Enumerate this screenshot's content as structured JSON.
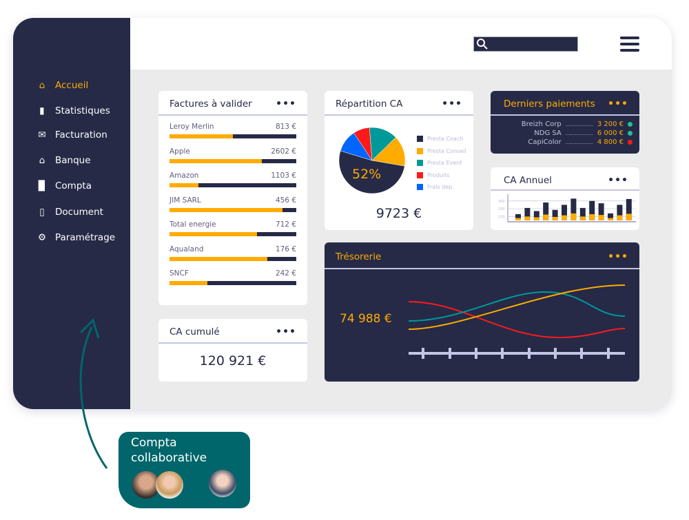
{
  "sidebar": {
    "items": [
      {
        "label": "Accueil",
        "icon": "home-icon",
        "active": true
      },
      {
        "label": "Statistiques",
        "icon": "bar-chart-icon"
      },
      {
        "label": "Facturation",
        "icon": "envelope-icon"
      },
      {
        "label": "Banque",
        "icon": "bank-icon"
      },
      {
        "label": "Compta",
        "icon": "book-icon"
      },
      {
        "label": "Document",
        "icon": "document-icon"
      },
      {
        "label": "Paramétrage",
        "icon": "gear-icon"
      }
    ]
  },
  "header": {
    "search_placeholder": "",
    "search_icon": "search-icon",
    "menu_icon": "hamburger-menu-icon"
  },
  "factures": {
    "title": "Factures à valider",
    "more": "•••",
    "items": [
      {
        "name": "Leroy Merlin",
        "amount": "813 €",
        "progress": 0.5
      },
      {
        "name": "Apple",
        "amount": "2602 €",
        "progress": 0.73
      },
      {
        "name": "Amazon",
        "amount": "1103 €",
        "progress": 0.23
      },
      {
        "name": "JIM SARL",
        "amount": "456 €",
        "progress": 0.89
      },
      {
        "name": "Total energie",
        "amount": "712 €",
        "progress": 0.69
      },
      {
        "name": "Aqualand",
        "amount": "176 €",
        "progress": 0.77
      },
      {
        "name": "SNCF",
        "amount": "242 €",
        "progress": 0.3
      }
    ]
  },
  "ca_cumule": {
    "title": "CA cumulé",
    "more": "•••",
    "value": "120 921 €"
  },
  "repartition": {
    "title": "Répartition CA",
    "more": "•••",
    "total": "9723 €",
    "center_label": "52%"
  },
  "paiements": {
    "title": "Derniers paiements",
    "more": "•••",
    "items": [
      {
        "name": "Breizh Corp",
        "dots": "..................",
        "amount": "3 200 €",
        "status": "#1fc28f"
      },
      {
        "name": "NDG SA",
        "dots": "..................",
        "amount": "6 000 €",
        "status": "#1fc28f"
      },
      {
        "name": "CapiColor",
        "dots": "..................",
        "amount": "4 800 €",
        "status": "#ff1a1a"
      }
    ]
  },
  "ca_annuel": {
    "title": "CA Annuel",
    "more": "•••"
  },
  "tresorerie": {
    "title": "Trésorerie",
    "more": "•••",
    "value": "74 988 €"
  },
  "badge": {
    "line1": "Compta",
    "line2": "collaborative",
    "avatars": 3
  },
  "colors": {
    "navy": "#262a47",
    "accent": "#ffab00",
    "teal": "#00666b",
    "red": "#ff1a1a",
    "blue": "#0066ff",
    "event": "#009999"
  },
  "chart_data": [
    {
      "type": "pie",
      "title": "Répartition CA",
      "slices": [
        {
          "name": "Presta Coach",
          "value": 52,
          "color": "#262a47"
        },
        {
          "name": "Presta Conseil",
          "value": 15,
          "color": "#ffab00"
        },
        {
          "name": "Presta Event",
          "value": 14,
          "color": "#009999"
        },
        {
          "name": "Produits",
          "value": 8,
          "color": "#ff1a1a"
        },
        {
          "name": "Frais dep.",
          "value": 11,
          "color": "#0066ff"
        }
      ]
    },
    {
      "type": "bar",
      "title": "CA Annuel",
      "stacked": true,
      "yticks": [
        100,
        200,
        300
      ],
      "ylim": [
        50,
        350
      ],
      "totals": [
        130,
        210,
        170,
        280,
        185,
        250,
        330,
        210,
        300,
        270,
        140,
        250,
        325
      ],
      "lower": [
        80,
        100,
        90,
        125,
        95,
        115,
        140,
        100,
        130,
        120,
        80,
        115,
        135
      ]
    }
  ]
}
